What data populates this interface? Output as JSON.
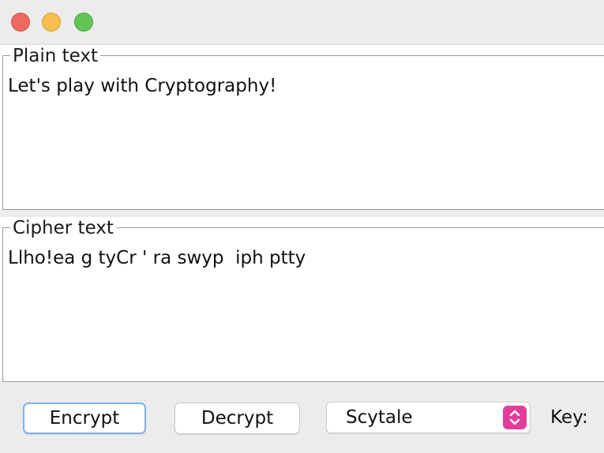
{
  "window": {
    "controls": [
      "close",
      "minimize",
      "maximize"
    ]
  },
  "plain_panel": {
    "title": "Plain text",
    "content": "Let's play with Cryptography!"
  },
  "cipher_panel": {
    "title": "Cipher text",
    "content": "Llho!ea g tyCr ' ra swyp  iph ptty"
  },
  "toolbar": {
    "encrypt_label": "Encrypt",
    "decrypt_label": "Decrypt",
    "cipher_select_value": "Scytale",
    "key_label": "Key:"
  },
  "colors": {
    "close": "#ee6a5f",
    "minimize": "#f5be4f",
    "maximize": "#62c654",
    "select_accent": "#e33c9a",
    "focus_ring": "#7fb3ea"
  }
}
